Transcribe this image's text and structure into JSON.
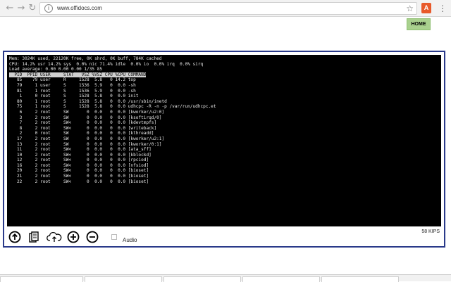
{
  "browser": {
    "url": "www.offidocs.com",
    "back_glyph": "←",
    "forward_glyph": "→",
    "reload_glyph": "↻",
    "info_glyph": "i",
    "star_glyph": "☆",
    "menu_glyph": "⋮",
    "extension_label": "A"
  },
  "header": {
    "home_label": "HOME"
  },
  "terminal": {
    "lines": [
      "Mem: 3024K used, 22120K free, 0K shrd, 0K buff, 784K cached",
      "CPU: 14.2% usr 14.2% sys  0.0% nic 71.4% idle  0.0% io  0.0% irq  0.0% sirq",
      "Load average: 0.00 0.00 0.00 1/35 85",
      "  PID  PPID USER     STAT   VSZ %VSZ CPU %CPU COMMAND",
      "   85    79 user     R     1528  5.8   0 14.2 top",
      "   79     1 user     S     1536  5.9   0  0.0 -sh",
      "   81     1 root     S     1536  5.9   0  0.0 -sh",
      "    1     0 root     S     1528  5.8   0  0.0 init",
      "   80     1 root     S     1528  5.8   0  0.0 /usr/sbin/inetd",
      "   75     1 root     S     1528  5.8   0  0.0 udhcpc -R -n -p /var/run/udhcpc.et",
      "    6     2 root     SW       0  0.0   0  0.0 [kworker/u2:0]",
      "    3     2 root     SW       0  0.0   0  0.0 [ksoftirqd/0]",
      "    7     2 root     SW<      0  0.0   0  0.0 [kdevtmpfs]",
      "    8     2 root     SW<      0  0.0   0  0.0 [writeback]",
      "    2     0 root     SW       0  0.0   0  0.0 [kthreadd]",
      "   17     2 root     SW       0  0.0   0  0.0 [kworker/u2:1]",
      "   13     2 root     SW       0  0.0   0  0.0 [kworker/0:1]",
      "   11     2 root     SW<      0  0.0   0  0.0 [ata_sff]",
      "   10     2 root     SW<      0  0.0   0  0.0 [kblockd]",
      "   12     2 root     SW<      0  0.0   0  0.0 [rpciod]",
      "   16     2 root     SW<      0  0.0   0  0.0 [nfsiod]",
      "   20     2 root     SW<      0  0.0   0  0.0 [bioset]",
      "   21     2 root     SW<      0  0.0   0  0.0 [bioset]",
      "   22     2 root     SW<      0  0.0   0  0.0 [bioset]"
    ],
    "header_line_index": 3
  },
  "toolbar": {
    "audio_label": "Audio",
    "audio_checked": false,
    "speed": "58 KIPS",
    "icons": [
      "upload-icon",
      "document-icon",
      "cloud-upload-icon",
      "zoom-in-icon",
      "zoom-out-icon"
    ]
  },
  "colors": {
    "home_button": "#a9d18e",
    "frame_border": "#2a3a8a",
    "terminal_bg": "#000000",
    "terminal_fg": "#e6e6e6"
  }
}
